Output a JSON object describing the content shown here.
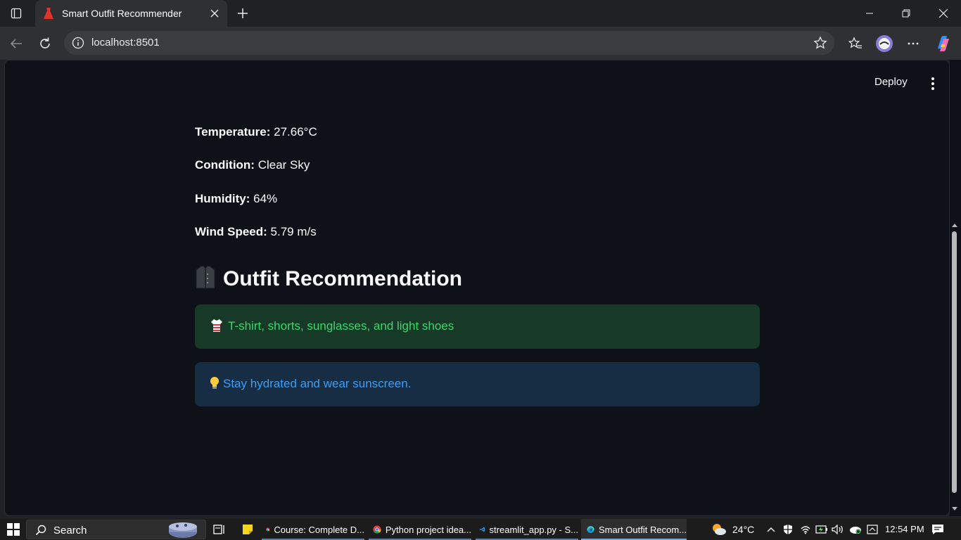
{
  "browser": {
    "tab_title": "Smart Outfit Recommender",
    "url": "localhost:8501"
  },
  "app": {
    "deploy_label": "Deploy",
    "weather": {
      "temperature_label": "Temperature:",
      "temperature_value": "27.66°C",
      "condition_label": "Condition:",
      "condition_value": "Clear Sky",
      "humidity_label": "Humidity:",
      "humidity_value": "64%",
      "wind_label": "Wind Speed:",
      "wind_value": "5.79 m/s"
    },
    "section_title": "Outfit Recommendation",
    "outfit_text": "T-shirt, shorts, sunglasses, and light shoes",
    "tip_text": "Stay hydrated and wear sunscreen.",
    "colors": {
      "background": "#0e1117",
      "success_bg": "#173928",
      "success_text": "#3dd56d",
      "info_bg": "#172d43",
      "info_text": "#3d9df3"
    }
  },
  "taskbar": {
    "search_label": "Search",
    "apps": [
      {
        "label": "Course: Complete D...",
        "icon": "chrome-icon"
      },
      {
        "label": "Python project idea...",
        "icon": "chrome-icon"
      },
      {
        "label": "streamlit_app.py - S...",
        "icon": "vscode-icon"
      },
      {
        "label": "Smart Outfit Recom...",
        "icon": "edge-icon"
      }
    ],
    "weather_temp": "24°C",
    "clock": "12:54 PM"
  }
}
